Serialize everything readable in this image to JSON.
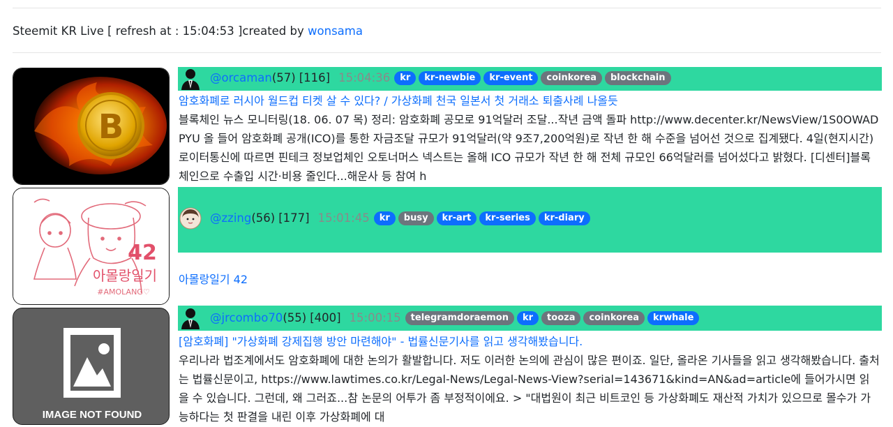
{
  "header": {
    "prefix": "Steemit KR Live [ refresh at : 15:04:53 ]created by",
    "author_link": "wonsama"
  },
  "posts": [
    {
      "author": "@orcaman",
      "reputation": "(57)",
      "count": "[116]",
      "time": "15:04:36",
      "tags": [
        {
          "label": "kr",
          "color": "blue"
        },
        {
          "label": "kr-newbie",
          "color": "blue"
        },
        {
          "label": "kr-event",
          "color": "blue"
        },
        {
          "label": "coinkorea",
          "color": "gray"
        },
        {
          "label": "blockchain",
          "color": "gray"
        }
      ],
      "title": "암호화폐로 러시아 월드컵 티켓 살 수 있다? / 가상화폐 천국 일본서 첫 거래소 퇴출사례 나올듯",
      "body": "블록체인 뉴스 모니터링(18. 06. 07 목) 정리: 암호화폐 공모로 91억달러 조달...작년 금액 돌파 http://www.decenter.kr/NewsView/1S0OWADPYU 올 들어 암호화폐 공개(ICO)를 통한 자금조달 규모가 91억달러(약 9조7,200억원)로 작년 한 해 수준을 넘어선 것으로 집계됐다. 4일(현지시간) 로이터통신에 따르면 핀테크 정보업체인 오토너머스 넥스트는 올해 ICO 규모가 작년 한 해 전체 규모인 66억달러를 넘어섰다고 밝혔다. [디센터]블록체인으로 수출입 시간·비용 줄인다...해운사 등 참여 h",
      "thumb_icon": "bitcoin-fire-icon"
    },
    {
      "author": "@zzing",
      "reputation": "(56)",
      "count": "[177]",
      "time": "15:01:45",
      "tags": [
        {
          "label": "kr",
          "color": "blue"
        },
        {
          "label": "busy",
          "color": "gray"
        },
        {
          "label": "kr-art",
          "color": "blue"
        },
        {
          "label": "kr-series",
          "color": "blue"
        },
        {
          "label": "kr-diary",
          "color": "blue"
        }
      ],
      "title": "아몰랑일기 42",
      "body": "",
      "thumb_icon": "amolang-drawing-icon",
      "thumb_texts": {
        "num": "42",
        "brand": "아몰랑일기",
        "tagline": "#AMOLANG♡"
      }
    },
    {
      "author": "@jrcombo70",
      "reputation": "(55)",
      "count": "[400]",
      "time": "15:00:15",
      "tags": [
        {
          "label": "telegramdoraemon",
          "color": "gray"
        },
        {
          "label": "kr",
          "color": "blue"
        },
        {
          "label": "tooza",
          "color": "gray"
        },
        {
          "label": "coinkorea",
          "color": "gray"
        },
        {
          "label": "krwhale",
          "color": "blue"
        }
      ],
      "title": "[암호화폐] \"가상화폐 강제집행 방안 마련해야\" - 법률신문기사를 읽고 생각해봤습니다.",
      "body": "우리나라 법조계에서도 암호화폐에 대한 논의가 활발합니다. 저도 이러한 논의에 관심이 많은 편이죠. 일단, 올라온 기사들을 읽고 생각해봤습니다. 출처는 법률신문이고, https://www.lawtimes.co.kr/Legal-News/Legal-News-View?serial=143671&kind=AN&ad=article에 들어가시면 읽을 수 있습니다. 그런데, 왜 그러죠...참 논문의 어투가 좀 부정적이에요. > \"대법원이 최근 비트코인 등 가상화폐도 재산적 가치가 있으므로 몰수가 가능하다는 첫 판결을 내린 이후 가상화폐에 대",
      "thumb_icon": "image-not-found-icon",
      "thumb_label": "IMAGE NOT FOUND"
    }
  ]
}
